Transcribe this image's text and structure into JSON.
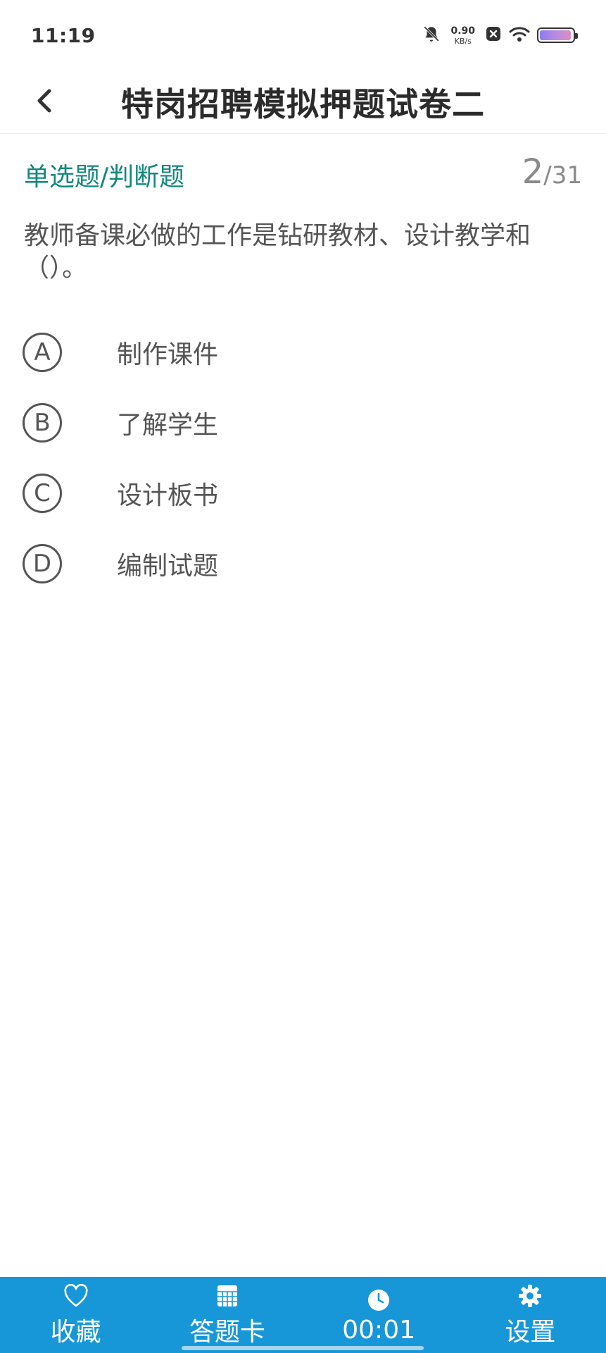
{
  "status_bar": {
    "time": "11:19",
    "net_speed_value": "0.90",
    "net_speed_unit": "KB/s",
    "battery_level": 0.95,
    "icons": [
      "bell-muted-icon",
      "close-box-icon",
      "wifi-icon",
      "battery-icon"
    ]
  },
  "header": {
    "title": "特岗招聘模拟押题试卷二",
    "back_icon": "chevron-left-icon"
  },
  "question": {
    "type_label": "单选题/判断题",
    "current": "2",
    "separator": "/",
    "total": "31",
    "text": "教师备课必做的工作是钻研教材、设计教学和（）。",
    "options": [
      {
        "letter": "A",
        "text": "制作课件"
      },
      {
        "letter": "B",
        "text": "了解学生"
      },
      {
        "letter": "C",
        "text": "设计板书"
      },
      {
        "letter": "D",
        "text": "编制试题"
      }
    ]
  },
  "bottom_bar": {
    "background": "#1797d8",
    "tabs": [
      {
        "label": "收藏",
        "icon": "heart-icon"
      },
      {
        "label": "答题卡",
        "icon": "grid-card-icon"
      },
      {
        "label": "00:01",
        "icon": "clock-icon"
      },
      {
        "label": "设置",
        "icon": "gear-icon"
      }
    ]
  },
  "colors": {
    "accent": "#13877d",
    "bar": "#1797d8"
  }
}
